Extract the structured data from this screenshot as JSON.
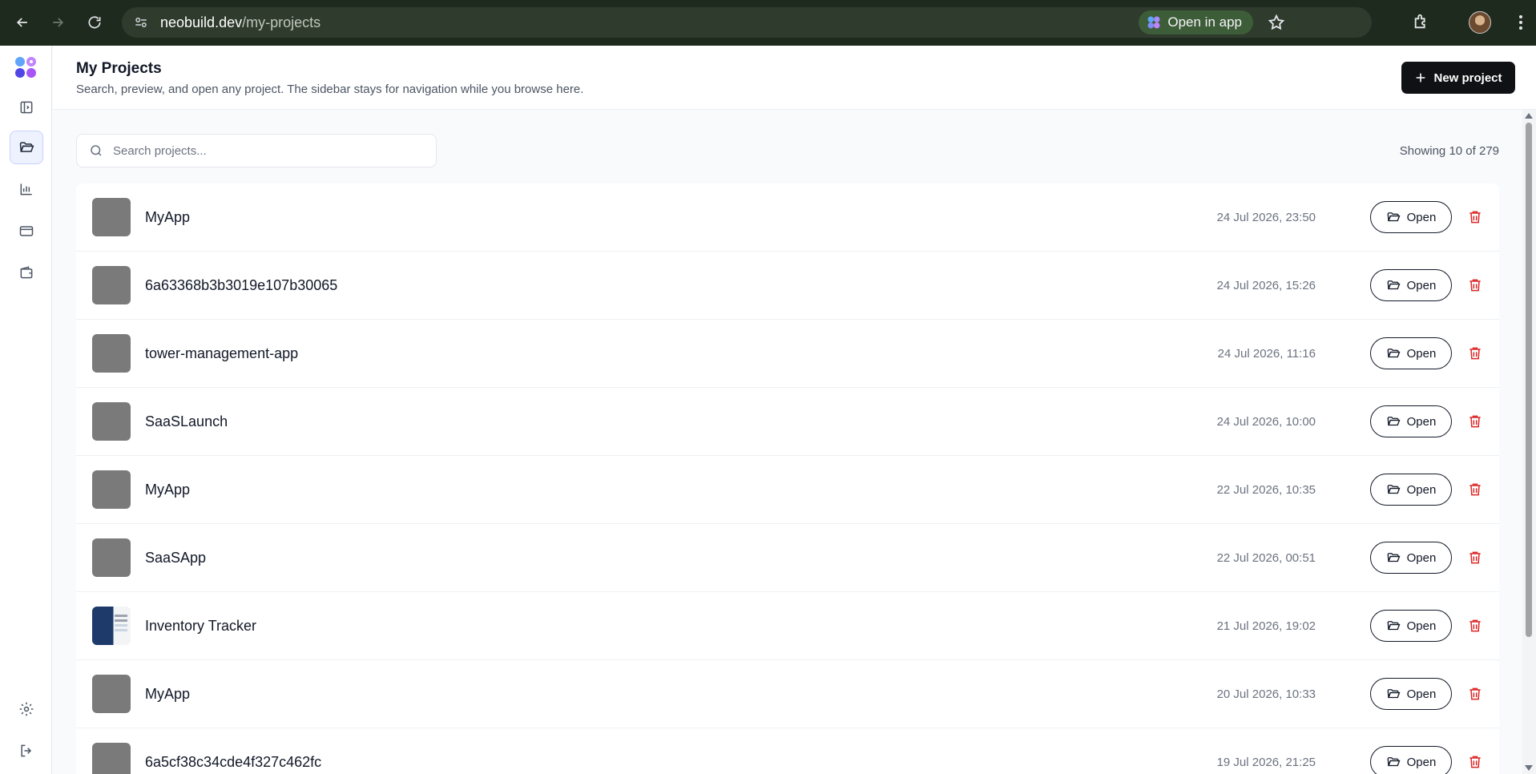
{
  "browser": {
    "url_host": "neobuild.dev",
    "url_path": "/my-projects",
    "open_in_app_label": "Open in app"
  },
  "header": {
    "title": "My Projects",
    "subtitle": "Search, preview, and open any project. The sidebar stays for navigation while you browse here.",
    "new_project_label": "New project"
  },
  "search": {
    "placeholder": "Search projects...",
    "showing_text": "Showing 10 of 279"
  },
  "projects": [
    {
      "name": "MyApp",
      "date": "24 Jul 2026, 23:50",
      "open_label": "Open"
    },
    {
      "name": "6a63368b3b3019e107b30065",
      "date": "24 Jul 2026, 15:26",
      "open_label": "Open"
    },
    {
      "name": "tower-management-app",
      "date": "24 Jul 2026, 11:16",
      "open_label": "Open"
    },
    {
      "name": "SaaSLaunch",
      "date": "24 Jul 2026, 10:00",
      "open_label": "Open"
    },
    {
      "name": "MyApp",
      "date": "22 Jul 2026, 10:35",
      "open_label": "Open"
    },
    {
      "name": "SaaSApp",
      "date": "22 Jul 2026, 00:51",
      "open_label": "Open"
    },
    {
      "name": "Inventory Tracker",
      "date": "21 Jul 2026, 19:02",
      "open_label": "Open"
    },
    {
      "name": "MyApp",
      "date": "20 Jul 2026, 10:33",
      "open_label": "Open"
    },
    {
      "name": "6a5cf38c34cde4f327c462fc",
      "date": "19 Jul 2026, 21:25",
      "open_label": "Open"
    }
  ],
  "colors": {
    "accent_dark": "#0f1115",
    "delete_red": "#dc2626",
    "chrome_bg": "#1f2a1e"
  }
}
